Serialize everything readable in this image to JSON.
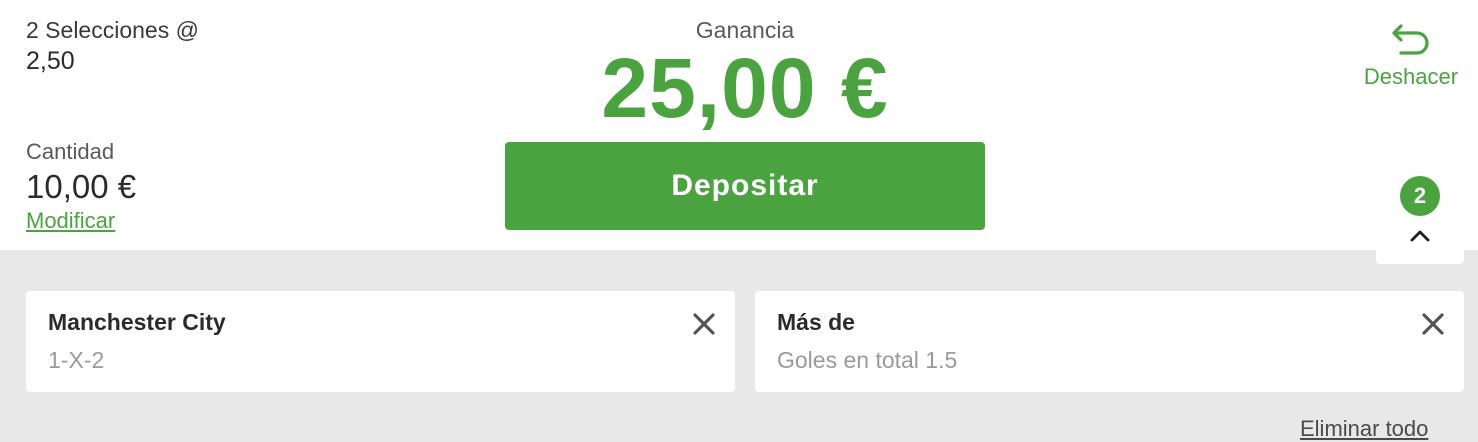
{
  "summary": {
    "selections_label": "2 Selecciones @",
    "odds": "2,50"
  },
  "stake": {
    "label": "Cantidad",
    "value": "10,00 €",
    "modify_link": "Modificar"
  },
  "winnings": {
    "label": "Ganancia",
    "value": "25,00 €"
  },
  "deposit_button": "Depositar",
  "undo": {
    "label": "Deshacer",
    "icon": "undo-arrow-icon"
  },
  "toggle": {
    "count": "2",
    "icon": "chevron-up-icon"
  },
  "selections": [
    {
      "title": "Manchester City",
      "market": "1-X-2",
      "close_icon": "close-icon"
    },
    {
      "title": "Más de",
      "market": "Goles en total 1.5",
      "close_icon": "close-icon"
    }
  ],
  "clear_all": "Eliminar todo",
  "colors": {
    "accent": "#4aa33f",
    "background_panel": "#e8e8e8",
    "card": "#ffffff"
  }
}
